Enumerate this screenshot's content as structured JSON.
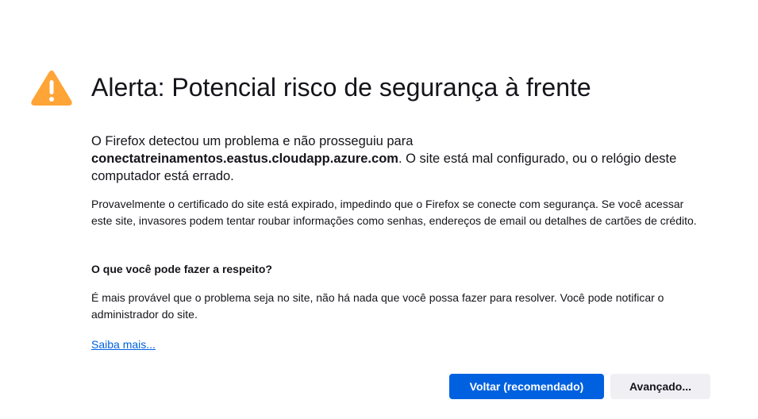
{
  "icons": {
    "warning": "warning-triangle-icon",
    "warning_color": "#ffa436"
  },
  "title": "Alerta: Potencial risco de segurança à frente",
  "intro": {
    "before": "O Firefox detectou um problema e não prosseguiu para",
    "hostname": "conectatreinamentos.eastus.cloudapp.azure.com",
    "after": ". O site está mal configurado, ou o relógio deste computador está errado."
  },
  "detail": "Provavelmente o certificado do site está expirado, impedindo que o Firefox se conecte com segurança. Se você acessar este site, invasores podem tentar roubar informações como senhas, endereços de email ou detalhes de cartões de crédito.",
  "what_to_do": {
    "heading": "O que você pode fazer a respeito?",
    "text": "É mais provável que o problema seja no site, não há nada que você possa fazer para resolver. Você pode notificar o administrador do site."
  },
  "learn_more": "Saiba mais...",
  "buttons": {
    "back": "Voltar (recomendado)",
    "advanced": "Avançado..."
  },
  "colors": {
    "primary": "#0061e0",
    "secondary_bg": "#f0f0f4",
    "text": "#15141a"
  }
}
